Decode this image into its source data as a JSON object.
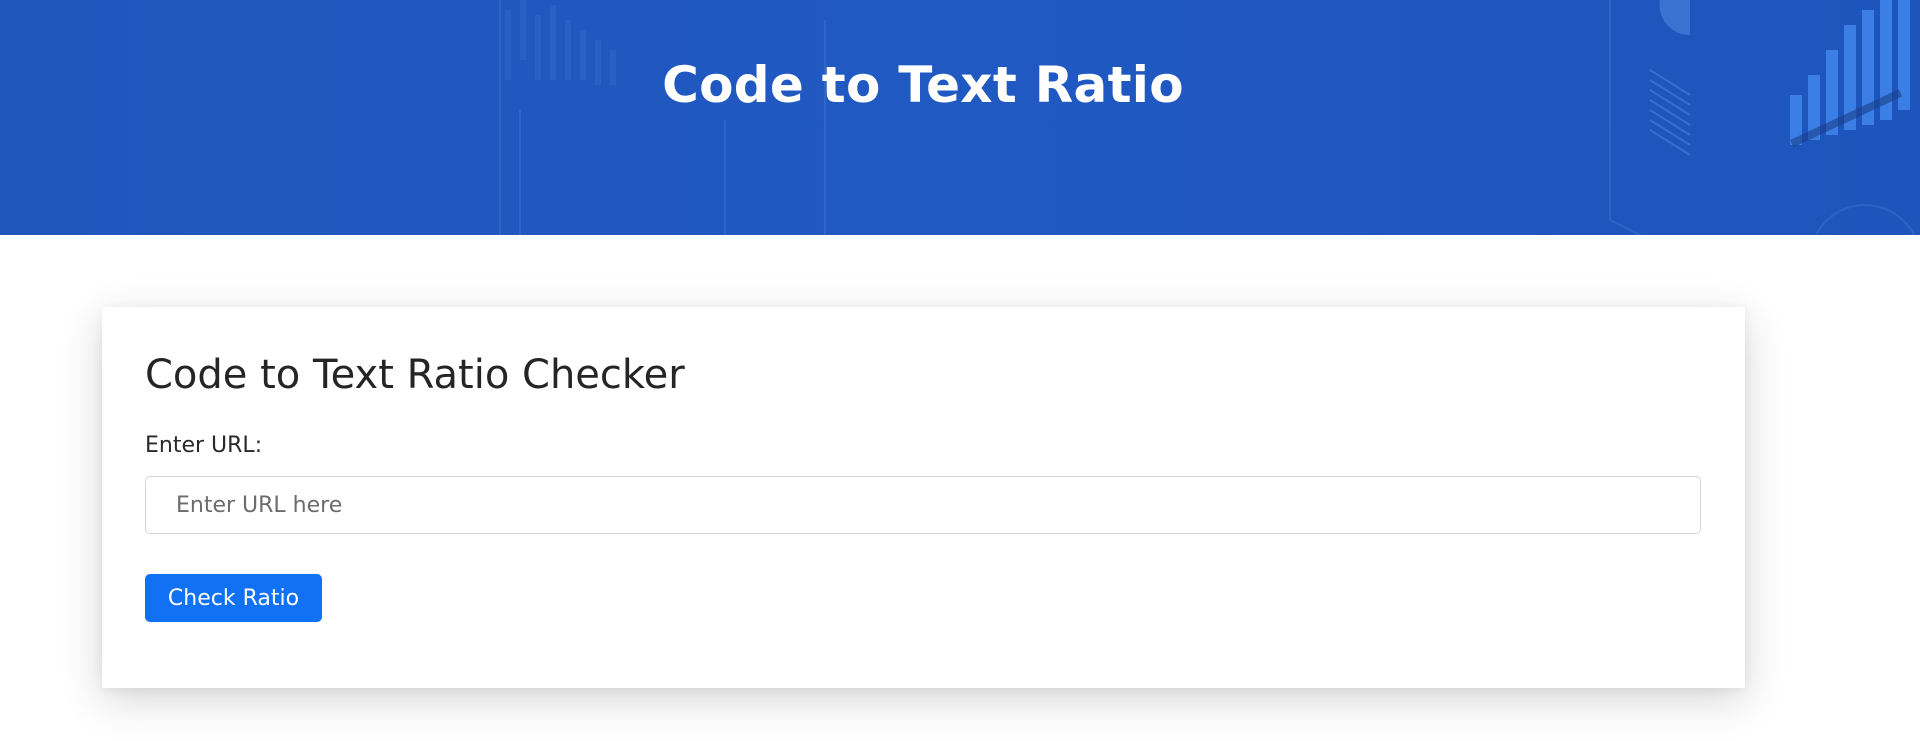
{
  "header": {
    "title": "Code to Text Ratio",
    "background_color": "#2159c2"
  },
  "form": {
    "title": "Code to Text Ratio Checker",
    "url_label": "Enter URL:",
    "url_placeholder": "Enter URL here",
    "url_value": "",
    "submit_label": "Check Ratio",
    "submit_color": "#1071f5"
  }
}
